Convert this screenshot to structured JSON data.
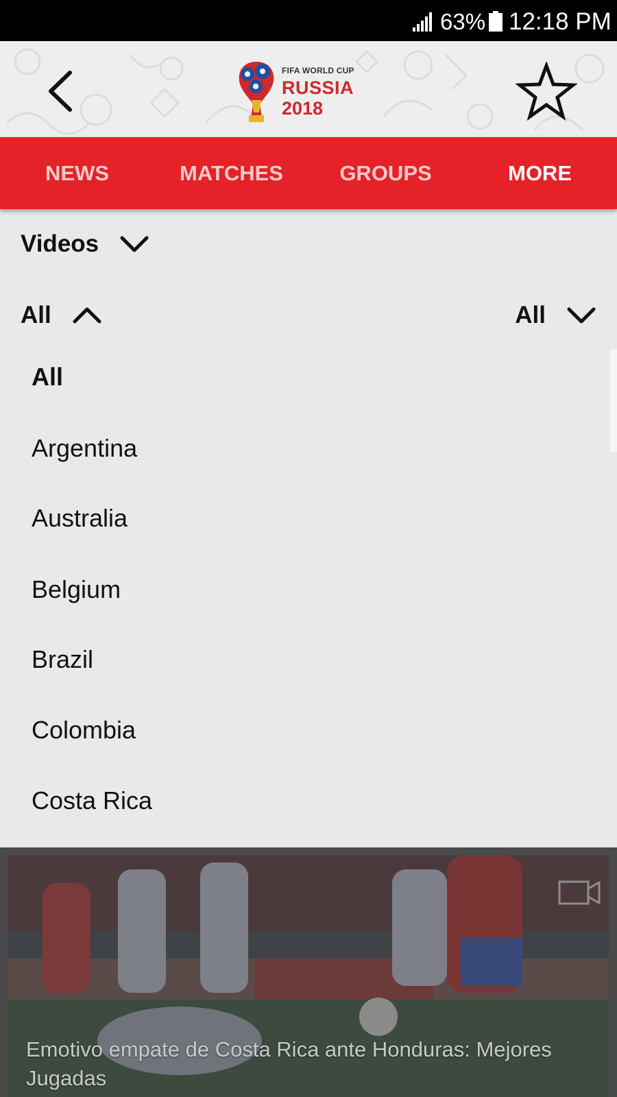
{
  "status_bar": {
    "battery_percent": "63%",
    "time": "12:18 PM"
  },
  "header": {
    "logo_small": "FIFA WORLD CUP",
    "logo_title": "RUSSIA",
    "logo_year": "2018"
  },
  "nav": {
    "tabs": [
      {
        "label": "NEWS"
      },
      {
        "label": "MATCHES"
      },
      {
        "label": "GROUPS"
      },
      {
        "label": "MORE"
      }
    ],
    "active_tab": "MORE",
    "accent_color": "#e42227"
  },
  "filters": {
    "category": "Videos",
    "team_filter": "All",
    "second_filter": "All"
  },
  "dropdown": {
    "items": [
      {
        "label": "All"
      },
      {
        "label": "Argentina"
      },
      {
        "label": "Australia"
      },
      {
        "label": "Belgium"
      },
      {
        "label": "Brazil"
      },
      {
        "label": "Colombia"
      },
      {
        "label": "Costa Rica"
      }
    ],
    "selected": "All"
  },
  "video": {
    "caption": "Emotivo empate de Costa Rica ante Honduras: Mejores Jugadas",
    "icon": "video-camera-icon"
  }
}
